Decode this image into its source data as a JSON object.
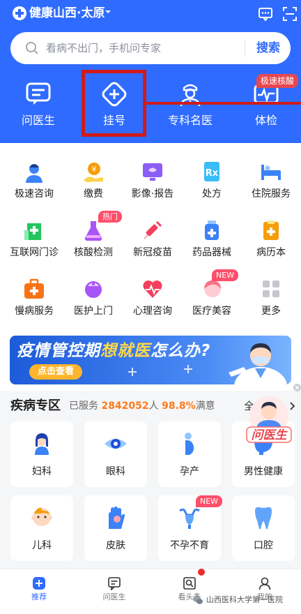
{
  "header": {
    "city": "健康山西·太原",
    "search_placeholder": "看病不出门，手机问专家",
    "search_button": "搜索"
  },
  "quick_actions": [
    {
      "label": "问医生",
      "icon": "chat-doc-icon"
    },
    {
      "label": "挂号",
      "icon": "plus-circle-icon"
    },
    {
      "label": "专科名医",
      "icon": "doctor-icon"
    },
    {
      "label": "体检",
      "icon": "ecg-icon"
    }
  ],
  "fast_badge": "极速核酸",
  "services": [
    {
      "label": "极速咨询",
      "icon": "nurse-icon",
      "color": "#3b82f6"
    },
    {
      "label": "缴费",
      "icon": "coin-hand-icon",
      "color": "#f59e0b"
    },
    {
      "label": "影像·报告",
      "icon": "monitor-icon",
      "color": "#8b5cf6"
    },
    {
      "label": "处方",
      "icon": "rx-icon",
      "color": "#38bdf8"
    },
    {
      "label": "住院服务",
      "icon": "bed-icon",
      "color": "#3b82f6"
    },
    {
      "label": "互联网门诊",
      "icon": "hospital-icon",
      "color": "#22c55e"
    },
    {
      "label": "核酸检测",
      "icon": "flask-icon",
      "color": "#a855f7"
    },
    {
      "label": "新冠疫苗",
      "icon": "syringe-icon",
      "color": "#f43f5e"
    },
    {
      "label": "药品器械",
      "icon": "medicine-bottle-icon",
      "color": "#3b82f6"
    },
    {
      "label": "病历本",
      "icon": "clipboard-icon",
      "color": "#f59e0b"
    },
    {
      "label": "慢病服务",
      "icon": "medkit-icon",
      "color": "#f97316"
    },
    {
      "label": "医护上门",
      "icon": "nurse-cap-icon",
      "color": "#a855f7"
    },
    {
      "label": "心理咨询",
      "icon": "heart-pulse-icon",
      "color": "#f43f5e"
    },
    {
      "label": "医疗美容",
      "icon": "beauty-face-icon",
      "color": "#fb7185"
    },
    {
      "label": "更多",
      "icon": "more-grid-icon",
      "color": "#c4c7cc"
    }
  ],
  "service_badges": {
    "hot": "热门",
    "new": "NEW"
  },
  "banner": {
    "title_a": "疫情管控期",
    "title_b": "想就医",
    "title_c": "怎么办?",
    "button": "点击查看"
  },
  "disease_zone": {
    "title": "疾病专区",
    "served_prefix": "已服务",
    "served_count": "2842052",
    "served_unit": "人",
    "satisfaction": "98.8%",
    "satisfaction_label": "满意",
    "all_link": "全部",
    "float_label": "问医生",
    "categories": [
      {
        "label": "妇科",
        "icon": "woman-icon"
      },
      {
        "label": "眼科",
        "icon": "eye-icon"
      },
      {
        "label": "孕产",
        "icon": "pregnant-icon"
      },
      {
        "label": "男性健康",
        "icon": "toilet-icon"
      },
      {
        "label": "儿科",
        "icon": "baby-icon"
      },
      {
        "label": "皮肤",
        "icon": "hand-skin-icon"
      },
      {
        "label": "不孕不育",
        "icon": "uterus-icon"
      },
      {
        "label": "口腔",
        "icon": "tooth-icon"
      }
    ],
    "new_badge": "NEW"
  },
  "tabbar": {
    "items": [
      {
        "label": "推荐",
        "icon": "home-plus-icon",
        "active": true
      },
      {
        "label": "问医生",
        "icon": "chat-icon",
        "active": false
      },
      {
        "label": "看头条",
        "icon": "news-icon",
        "active": false
      },
      {
        "label": "我的",
        "icon": "user-icon",
        "active": false
      }
    ]
  },
  "watermark": "山西医科大学第一医院",
  "colors": {
    "brand": "#2f6bff",
    "highlight": "#d11a1a",
    "accent": "#ff7a1a"
  }
}
